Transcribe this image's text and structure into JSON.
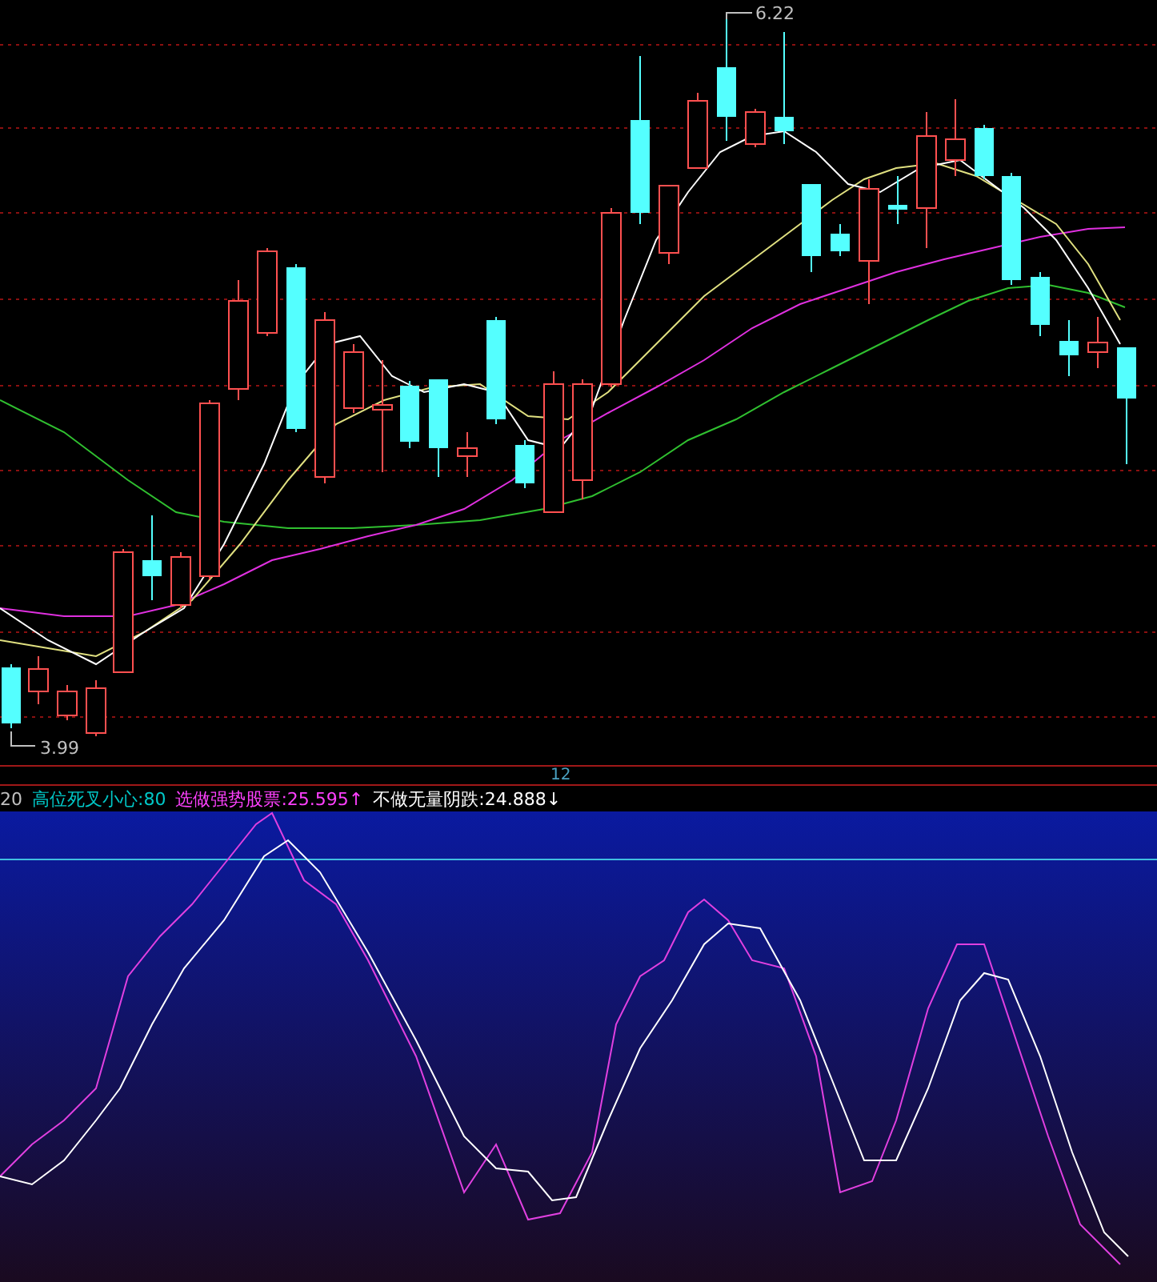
{
  "price_chart": {
    "high_label": "6.22",
    "low_label": "3.99"
  },
  "time_axis": {
    "label": "12"
  },
  "indicator": {
    "legend": [
      {
        "text": "20",
        "color": "#c0c0c0"
      },
      {
        "text": "高位死叉小心:80",
        "color": "#00c8c8"
      },
      {
        "text": "选做强势股票:25.595",
        "arrow": "↑",
        "color": "#ff40ff"
      },
      {
        "text": "不做无量阴跌:24.888",
        "arrow": "↓",
        "color": "#ffffff"
      }
    ]
  }
}
